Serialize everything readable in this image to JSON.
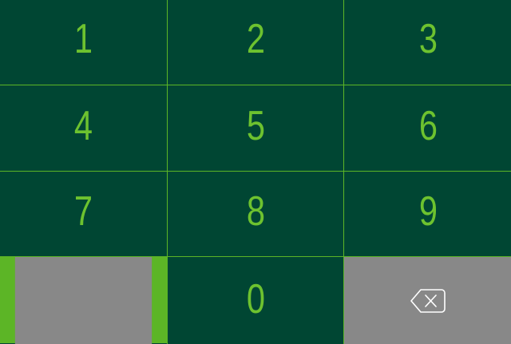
{
  "keypad": {
    "keys": {
      "k1": "1",
      "k2": "2",
      "k3": "3",
      "k4": "4",
      "k5": "5",
      "k6": "6",
      "k7": "7",
      "k8": "8",
      "k9": "9",
      "k0": "0"
    },
    "backspace_icon": "backspace-icon",
    "colors": {
      "key_background": "#004633",
      "digit": "#6dc22f",
      "divider": "#5cb526",
      "inactive_key": "#888888",
      "icon_stroke": "#ffffff"
    }
  }
}
